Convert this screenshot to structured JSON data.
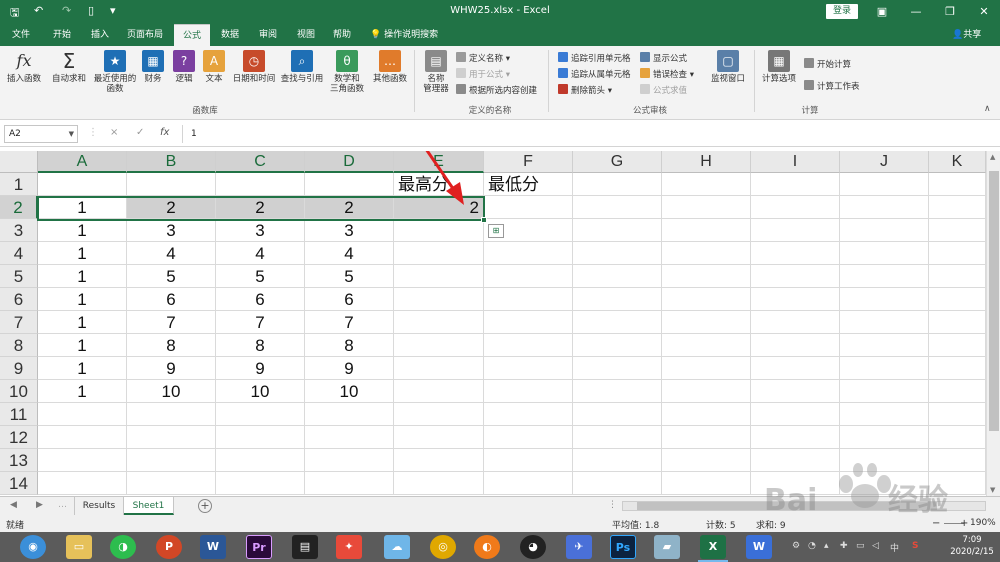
{
  "titlebar": {
    "title": "WHW25.xlsx  -  Excel",
    "login": "登录",
    "save_icon": "save-icon",
    "undo_icon": "undo-icon",
    "redo_icon": "redo-icon",
    "new_icon": "new-file-icon",
    "qa_icon": "customize-icon"
  },
  "tabs": [
    "文件",
    "开始",
    "插入",
    "页面布局",
    "公式",
    "数据",
    "审阅",
    "视图",
    "帮助"
  ],
  "active_tab": "公式",
  "tell_me": "操作说明搜索",
  "share": "共享",
  "ribbon": {
    "buttons": [
      {
        "label": "插入函数",
        "icon": "fx",
        "color": "#ffffff"
      },
      {
        "label": "自动求和",
        "icon": "Σ",
        "color": "#444444"
      },
      {
        "label": "最近使用的\n函数",
        "icon": "★",
        "color": "#1f6fb5"
      },
      {
        "label": "财务",
        "icon": "▦",
        "color": "#1f6fb5"
      },
      {
        "label": "逻辑",
        "icon": "?",
        "color": "#7b3fa0"
      },
      {
        "label": "文本",
        "icon": "A",
        "color": "#e6a23c"
      },
      {
        "label": "日期和时间",
        "icon": "◷",
        "color": "#c74b2b"
      },
      {
        "label": "查找与引用",
        "icon": "⌕",
        "color": "#1f6fb5"
      },
      {
        "label": "数学和\n三角函数",
        "icon": "θ",
        "color": "#3a9a5b"
      },
      {
        "label": "其他函数",
        "icon": "…",
        "color": "#e07b2b"
      },
      {
        "label": "名称\n管理器",
        "icon": "▤",
        "color": "#8a8a8a"
      },
      {
        "label": "监视窗口",
        "icon": "▢",
        "color": "#5a7fa8"
      },
      {
        "label": "计算选项",
        "icon": "▦",
        "color": "#777777"
      }
    ],
    "name_items": [
      "定义名称 ▾",
      "用于公式 ▾",
      "根据所选内容创建"
    ],
    "audit_items_left": [
      "追踪引用单元格",
      "追踪从属单元格",
      "删除箭头 ▾"
    ],
    "audit_items_right": [
      "显示公式",
      "错误检查 ▾",
      "公式求值"
    ],
    "calc_items": [
      "开始计算",
      "计算工作表"
    ],
    "groups": [
      "函数库",
      "定义的名称",
      "公式审核",
      "计算"
    ]
  },
  "formula_bar": {
    "name_box": "A2",
    "value": "1",
    "fx": "fx",
    "cancel": "×",
    "enter": "✓"
  },
  "columns": [
    "A",
    "B",
    "C",
    "D",
    "E",
    "F",
    "G",
    "H",
    "I",
    "J",
    "K"
  ],
  "rows": [
    "1",
    "2",
    "3",
    "4",
    "5",
    "6",
    "7",
    "8",
    "9",
    "10",
    "11",
    "12",
    "13",
    "14"
  ],
  "cells": {
    "E1": "最高分",
    "F1": "最低分",
    "A2": "1",
    "B2": "2",
    "C2": "2",
    "D2": "2",
    "E2": "2",
    "A3": "1",
    "B3": "3",
    "C3": "3",
    "D3": "3",
    "A4": "1",
    "B4": "4",
    "C4": "4",
    "D4": "4",
    "A5": "1",
    "B5": "5",
    "C5": "5",
    "D5": "5",
    "A6": "1",
    "B6": "6",
    "C6": "6",
    "D6": "6",
    "A7": "1",
    "B7": "7",
    "C7": "7",
    "D7": "7",
    "A8": "1",
    "B8": "8",
    "C8": "8",
    "D8": "8",
    "A9": "1",
    "B9": "9",
    "C9": "9",
    "D9": "9",
    "A10": "1",
    "B10": "10",
    "C10": "10",
    "D10": "10"
  },
  "selection": {
    "range": "A2:E2",
    "active": "A2"
  },
  "sheets": [
    "Results",
    "Sheet1"
  ],
  "active_sheet": "Sheet1",
  "status": {
    "ready": "就绪",
    "average": "平均值: 1.8",
    "count": "计数: 5",
    "sum": "求和: 9",
    "zoom": "190%"
  },
  "taskbar": {
    "apps": [
      "browser",
      "explorer",
      "wechat",
      "powerpoint",
      "word",
      "premiere",
      "video",
      "app",
      "app2",
      "chrome",
      "app3",
      "qq",
      "app4",
      "photoshop",
      "app5",
      "excel",
      "wps"
    ],
    "time": "7:09",
    "date": "2020/2/15"
  },
  "watermark": "Baidu经验 jingyan.baidu.com"
}
